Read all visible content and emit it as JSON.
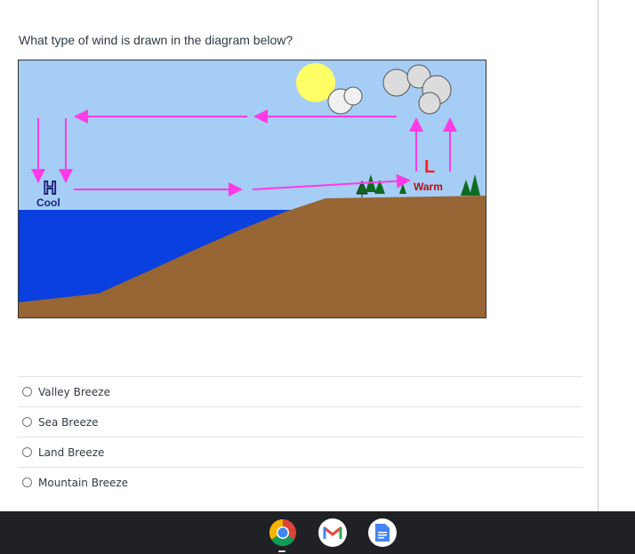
{
  "question": {
    "text": "What type of wind is drawn in the diagram below?"
  },
  "diagram": {
    "high_label": "H",
    "cool_label": "Cool",
    "low_label": "L",
    "warm_label": "Warm",
    "colors": {
      "sky": "#a6cdf5",
      "water": "#0a3fe0",
      "land": "#976634",
      "arrow": "#ff3ae6",
      "sun": "#ffff66"
    }
  },
  "answers": [
    {
      "label": "Valley Breeze"
    },
    {
      "label": "Sea Breeze"
    },
    {
      "label": "Land Breeze"
    },
    {
      "label": "Mountain Breeze"
    }
  ],
  "taskbar": {
    "apps": [
      "chrome-icon",
      "gmail-icon",
      "google-docs-icon"
    ]
  }
}
